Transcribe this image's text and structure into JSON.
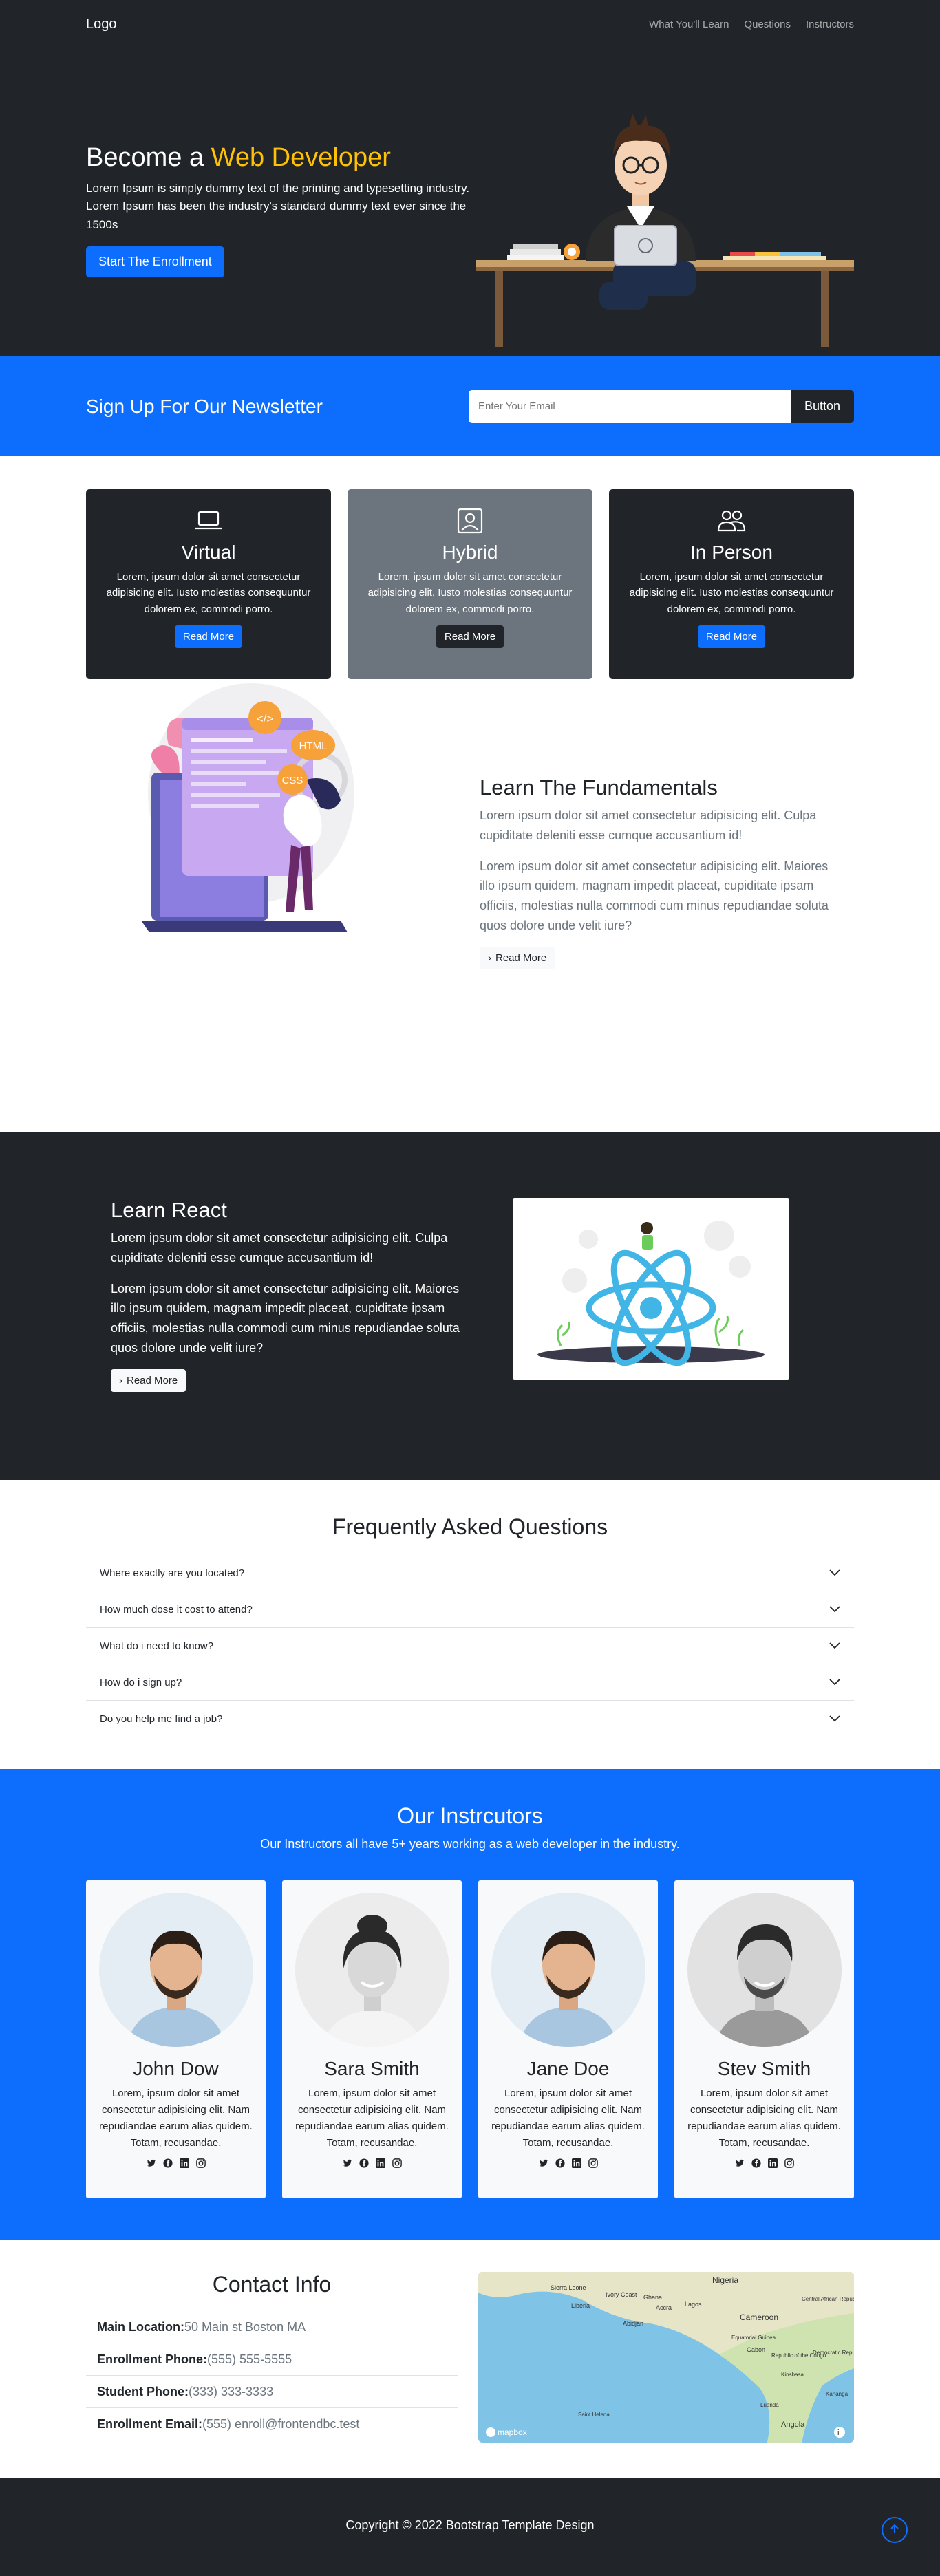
{
  "nav": {
    "logo": "Logo",
    "links": [
      "What You'll Learn",
      "Questions",
      "Instructors"
    ]
  },
  "hero": {
    "title_prefix": "Become a",
    "title_accent": "Web Developer",
    "text": "Lorem Ipsum is simply dummy text of the printing and typesetting industry. Lorem Ipsum has been the industry's standard dummy text ever since the 1500s",
    "button": "Start The Enrollment"
  },
  "newsletter": {
    "title": "Sign Up For Our Newsletter",
    "placeholder": "Enter Your Email",
    "button": "Button"
  },
  "boxes": [
    {
      "title": "Virtual",
      "text": "Lorem, ipsum dolor sit amet consectetur adipisicing elit. Iusto molestias consequuntur dolorem ex, commodi porro.",
      "button": "Read More",
      "icon": "laptop-icon"
    },
    {
      "title": "Hybrid",
      "text": "Lorem, ipsum dolor sit amet consectetur adipisicing elit. Iusto molestias consequuntur dolorem ex, commodi porro.",
      "button": "Read More",
      "icon": "person-square-icon"
    },
    {
      "title": "In Person",
      "text": "Lorem, ipsum dolor sit amet consectetur adipisicing elit. Iusto molestias consequuntur dolorem ex, commodi porro.",
      "button": "Read More",
      "icon": "people-icon"
    }
  ],
  "fundamentals": {
    "title": "Learn The Fundamentals",
    "p1": "Lorem ipsum dolor sit amet consectetur adipisicing elit. Culpa cupiditate deleniti esse cumque accusantium id!",
    "p2": "Lorem ipsum dolor sit amet consectetur adipisicing elit. Maiores illo ipsum quidem, magnam impedit placeat, cupiditate ipsam officiis, molestias nulla commodi cum minus repudiandae soluta quos dolore unde velit iure?",
    "button": "Read More",
    "badges": [
      "</>",
      "HTML",
      "CSS"
    ]
  },
  "react": {
    "title": "Learn React",
    "p1": "Lorem ipsum dolor sit amet consectetur adipisicing elit. Culpa cupiditate deleniti esse cumque accusantium id!",
    "p2": "Lorem ipsum dolor sit amet consectetur adipisicing elit. Maiores illo ipsum quidem, magnam impedit placeat, cupiditate ipsam officiis, molestias nulla commodi cum minus repudiandae soluta quos dolore unde velit iure?",
    "button": "Read More"
  },
  "faq": {
    "title": "Frequently Asked Questions",
    "items": [
      "Where exactly are you located?",
      "How much dose it cost to attend?",
      "What do i need to know?",
      "How do i sign up?",
      "Do you help me find a job?"
    ]
  },
  "instructors": {
    "title": "Our Instrcutors",
    "lead": "Our Instructors all have 5+ years working as a web developer in the industry.",
    "people": [
      {
        "name": "John Dow",
        "text": "Lorem, ipsum dolor sit amet consectetur adipisicing elit. Nam repudiandae earum alias quidem. Totam, recusandae."
      },
      {
        "name": "Sara Smith",
        "text": "Lorem, ipsum dolor sit amet consectetur adipisicing elit. Nam repudiandae earum alias quidem. Totam, recusandae."
      },
      {
        "name": "Jane Doe",
        "text": "Lorem, ipsum dolor sit amet consectetur adipisicing elit. Nam repudiandae earum alias quidem. Totam, recusandae."
      },
      {
        "name": "Stev Smith",
        "text": "Lorem, ipsum dolor sit amet consectetur adipisicing elit. Nam repudiandae earum alias quidem. Totam, recusandae."
      }
    ]
  },
  "contact": {
    "title": "Contact Info",
    "rows": [
      {
        "label": "Main Location:",
        "value": "50 Main st Boston MA"
      },
      {
        "label": "Enrollment Phone:",
        "value": "(555) 555-5555"
      },
      {
        "label": "Student Phone:",
        "value": "(333) 333-3333"
      },
      {
        "label": "Enrollment Email:",
        "value": "(555) enroll@frontendbc.test"
      }
    ],
    "map_labels": [
      "Nigeria",
      "Sierra Leone",
      "Ivory Coast",
      "Liberia",
      "Accra",
      "Lagos",
      "Abidjan",
      "Ghana",
      "Cameroon",
      "Central African Republic",
      "Equatorial Guinea",
      "Gabon",
      "Republic of the Congo",
      "Democratic Republic of the Congo",
      "Kinshasa",
      "Luanda",
      "Angola",
      "Saint Helena",
      "Kananga"
    ],
    "map_brand": "mapbox"
  },
  "footer": {
    "copyright": "Copyright © 2022 Bootstrap Template Design"
  },
  "colors": {
    "primary": "#0d6efd",
    "dark": "#212529",
    "gray": "#6c757d",
    "accent": "#ffc107"
  }
}
